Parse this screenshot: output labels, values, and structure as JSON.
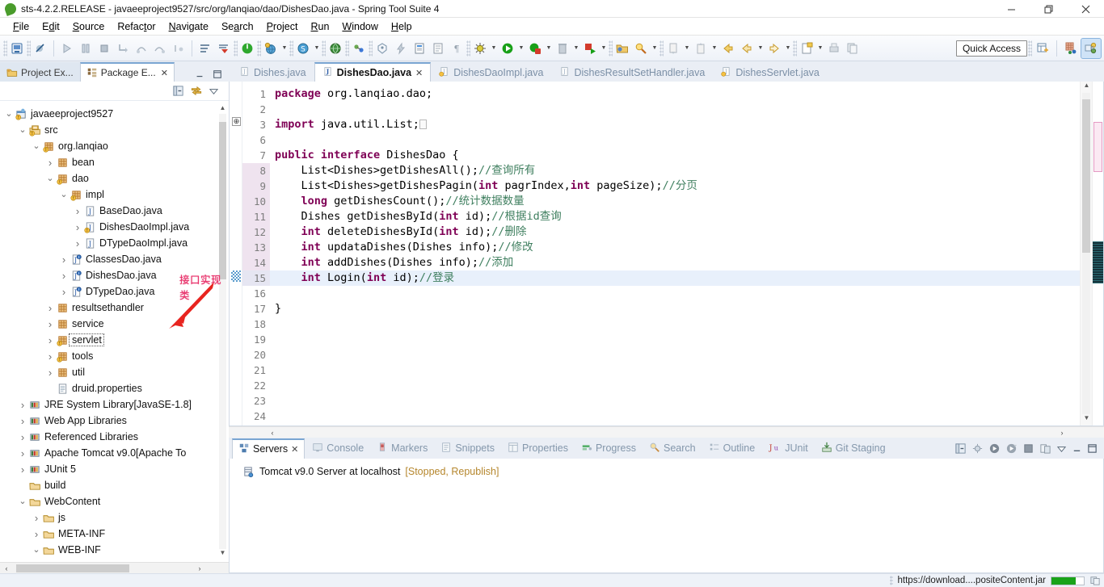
{
  "window": {
    "title": "sts-4.2.2.RELEASE - javaeeproject9527/src/org/lanqiao/dao/DishesDao.java - Spring Tool Suite 4",
    "minimize": "–",
    "maximize": "❐",
    "close": "✕"
  },
  "menubar": [
    {
      "label": "File"
    },
    {
      "label": "Edit"
    },
    {
      "label": "Source"
    },
    {
      "label": "Refactor"
    },
    {
      "label": "Navigate"
    },
    {
      "label": "Search"
    },
    {
      "label": "Project"
    },
    {
      "label": "Run"
    },
    {
      "label": "Window"
    },
    {
      "label": "Help"
    }
  ],
  "toolbar": {
    "quick_access": "Quick Access",
    "buttons": [
      "new-wizard-icon",
      "save-icon",
      "run-last-tool-icon",
      "step-over-icon",
      "terminate-icon",
      "skip-breakpoints-icon",
      "debug-step-icon",
      "debug-step-return-icon",
      "debug-resume-icon",
      "external-tools-icon",
      "boot-dashboard-icon",
      "run-as-spring-icon",
      "spring-boot-icon",
      "live-beans-icon",
      "globe-icon",
      "validate-icon",
      "search-ref-icon",
      "lightning-icon",
      "new-java-class-icon",
      "new-package-icon",
      "toggle-mark-occurrences-icon",
      "debug-icon",
      "run-icon",
      "coverage-icon",
      "delete-icon",
      "run-config-icon",
      "open-type-icon",
      "search-icon",
      "next-annotation-icon",
      "previous-annotation-icon",
      "back-icon",
      "forward-icon",
      "new-file-icon",
      "print-icon",
      "copy-icon"
    ],
    "perspectives": [
      "open-perspective-icon",
      "java-ee-perspective-icon",
      "java-perspective-icon"
    ]
  },
  "explorer": {
    "tabs": [
      {
        "label": "Project Ex...",
        "icon": "project-explorer-icon",
        "active": false,
        "closable": false
      },
      {
        "label": "Package E...",
        "icon": "package-explorer-icon",
        "active": true,
        "closable": true
      }
    ],
    "view_tools": [
      "collapse-all-icon",
      "link-with-editor-icon",
      "view-menu-icon"
    ],
    "annotation": "接口实现类",
    "tree": [
      {
        "depth": 0,
        "twist": "v",
        "icon": "java-project-icon",
        "label": "javaeeproject9527",
        "warn": true
      },
      {
        "depth": 1,
        "twist": "v",
        "icon": "source-folder-icon",
        "label": "src",
        "warn": true
      },
      {
        "depth": 2,
        "twist": "v",
        "icon": "package-icon",
        "label": "org.lanqiao",
        "warn": true
      },
      {
        "depth": 3,
        "twist": ">",
        "icon": "package-icon",
        "label": "bean"
      },
      {
        "depth": 3,
        "twist": "v",
        "icon": "package-icon",
        "label": "dao",
        "warn": true
      },
      {
        "depth": 4,
        "twist": "v",
        "icon": "package-icon",
        "label": "impl",
        "warn": true
      },
      {
        "depth": 5,
        "twist": ">",
        "icon": "java-file-icon",
        "label": "BaseDao.java"
      },
      {
        "depth": 5,
        "twist": ">",
        "icon": "java-file-icon",
        "label": "DishesDaoImpl.java",
        "warn": true
      },
      {
        "depth": 5,
        "twist": ">",
        "icon": "java-file-icon",
        "label": "DTypeDaoImpl.java"
      },
      {
        "depth": 4,
        "twist": ">",
        "icon": "java-interface-icon",
        "label": "ClassesDao.java"
      },
      {
        "depth": 4,
        "twist": ">",
        "icon": "java-interface-icon",
        "label": "DishesDao.java"
      },
      {
        "depth": 4,
        "twist": ">",
        "icon": "java-interface-icon",
        "label": "DTypeDao.java"
      },
      {
        "depth": 3,
        "twist": ">",
        "icon": "package-icon",
        "label": "resultsethandler"
      },
      {
        "depth": 3,
        "twist": ">",
        "icon": "package-icon",
        "label": "service"
      },
      {
        "depth": 3,
        "twist": ">",
        "icon": "package-icon",
        "label": "servlet",
        "warn": true,
        "focused": true
      },
      {
        "depth": 3,
        "twist": ">",
        "icon": "package-icon",
        "label": "tools",
        "warn": true
      },
      {
        "depth": 3,
        "twist": ">",
        "icon": "package-icon",
        "label": "util"
      },
      {
        "depth": 3,
        "twist": "",
        "icon": "properties-file-icon",
        "label": "druid.properties"
      },
      {
        "depth": 1,
        "twist": ">",
        "icon": "library-icon",
        "label": "JRE System Library ",
        "suffix": "[JavaSE-1.8]"
      },
      {
        "depth": 1,
        "twist": ">",
        "icon": "library-icon",
        "label": "Web App Libraries"
      },
      {
        "depth": 1,
        "twist": ">",
        "icon": "library-icon",
        "label": "Referenced Libraries"
      },
      {
        "depth": 1,
        "twist": ">",
        "icon": "library-icon",
        "label": "Apache Tomcat v9.0 ",
        "suffix": "[Apache To"
      },
      {
        "depth": 1,
        "twist": ">",
        "icon": "library-icon",
        "label": "JUnit 5"
      },
      {
        "depth": 1,
        "twist": "",
        "icon": "folder-icon",
        "label": "build"
      },
      {
        "depth": 1,
        "twist": "v",
        "icon": "folder-icon",
        "label": "WebContent"
      },
      {
        "depth": 2,
        "twist": ">",
        "icon": "folder-icon",
        "label": "js"
      },
      {
        "depth": 2,
        "twist": ">",
        "icon": "folder-icon",
        "label": "META-INF"
      },
      {
        "depth": 2,
        "twist": "v",
        "icon": "folder-icon",
        "label": "WEB-INF"
      }
    ]
  },
  "editor": {
    "tabs": [
      {
        "label": "Dishes.java",
        "active": false,
        "dirty": false
      },
      {
        "label": "DishesDao.java",
        "active": true,
        "dirty": false
      },
      {
        "label": "DishesDaoImpl.java",
        "active": false,
        "warn": true
      },
      {
        "label": "DishesResultSetHandler.java",
        "active": false
      },
      {
        "label": "DishesServlet.java",
        "active": false,
        "warn": true
      }
    ],
    "lines": [
      {
        "n": 1,
        "html": "<span class=\"kw\">package</span> org.lanqiao.dao;"
      },
      {
        "n": 2,
        "html": ""
      },
      {
        "n": 3,
        "html": "<span class=\"kw\">import</span> java.util.List;<span class=\"collapse-box\"></span>",
        "fold": true
      },
      {
        "n": 6,
        "html": ""
      },
      {
        "n": 7,
        "html": "<span class=\"kw\">public</span> <span class=\"kw\">interface</span> DishesDao {"
      },
      {
        "n": 8,
        "html": "    List&lt;Dishes&gt;getDishesAll();<span class=\"cm\">//查询所有</span>",
        "mark": true
      },
      {
        "n": 9,
        "html": "    List&lt;Dishes&gt;getDishesPagin(<span class=\"kw\">int</span> pagrIndex,<span class=\"kw\">int</span> pageSize);<span class=\"cm\">//分页</span>",
        "mark": true
      },
      {
        "n": 10,
        "html": "    <span class=\"kw\">long</span> getDishesCount();<span class=\"cm\">//统计数据数量</span>",
        "mark": true
      },
      {
        "n": 11,
        "html": "    Dishes getDishesById(<span class=\"kw\">int</span> id);<span class=\"cm\">//根据id查询</span>",
        "mark": true
      },
      {
        "n": 12,
        "html": "    <span class=\"kw\">int</span> deleteDishesById(<span class=\"kw\">int</span> id);<span class=\"cm\">//删除</span>",
        "mark": true
      },
      {
        "n": 13,
        "html": "    <span class=\"kw\">int</span> updataDishes(Dishes info);<span class=\"cm\">//修改</span>",
        "mark": true
      },
      {
        "n": 14,
        "html": "    <span class=\"kw\">int</span> addDishes(Dishes info);<span class=\"cm\">//添加</span>",
        "mark": true
      },
      {
        "n": 15,
        "html": "    <span class=\"kw\">int</span> Login(<span class=\"kw\">int</span> id);<span class=\"cm\">//登录</span>",
        "cursor": true
      },
      {
        "n": 16,
        "html": ""
      },
      {
        "n": 17,
        "html": "}"
      },
      {
        "n": 18,
        "html": ""
      },
      {
        "n": 19,
        "html": ""
      },
      {
        "n": 20,
        "html": ""
      },
      {
        "n": 21,
        "html": ""
      },
      {
        "n": 22,
        "html": ""
      },
      {
        "n": 23,
        "html": ""
      },
      {
        "n": 24,
        "html": ""
      }
    ]
  },
  "bottom": {
    "tabs": [
      {
        "label": "Servers",
        "icon": "servers-icon",
        "active": true,
        "closable": true
      },
      {
        "label": "Console",
        "icon": "console-icon",
        "active": false
      },
      {
        "label": "Markers",
        "icon": "markers-icon",
        "active": false
      },
      {
        "label": "Snippets",
        "icon": "snippets-icon",
        "active": false
      },
      {
        "label": "Properties",
        "icon": "properties-icon",
        "active": false
      },
      {
        "label": "Progress",
        "icon": "progress-icon",
        "active": false
      },
      {
        "label": "Search",
        "icon": "search-icon",
        "active": false
      },
      {
        "label": "Outline",
        "icon": "outline-icon",
        "active": false
      },
      {
        "label": "JUnit",
        "icon": "junit-icon",
        "active": false
      },
      {
        "label": "Git Staging",
        "icon": "git-staging-icon",
        "active": false
      }
    ],
    "tools": [
      "collapse-all-icon",
      "debug-server-icon",
      "start-server-icon",
      "profile-server-icon",
      "stop-server-icon",
      "publish-icon",
      "view-menu-icon",
      "minimize-icon",
      "maximize-icon"
    ],
    "server": {
      "name": "Tomcat v9.0 Server at localhost",
      "state": "[Stopped, Republish]",
      "icon": "tomcat-server-icon"
    }
  },
  "statusbar": {
    "message": "https://download....positeContent.jar",
    "progress_percent": 76
  }
}
